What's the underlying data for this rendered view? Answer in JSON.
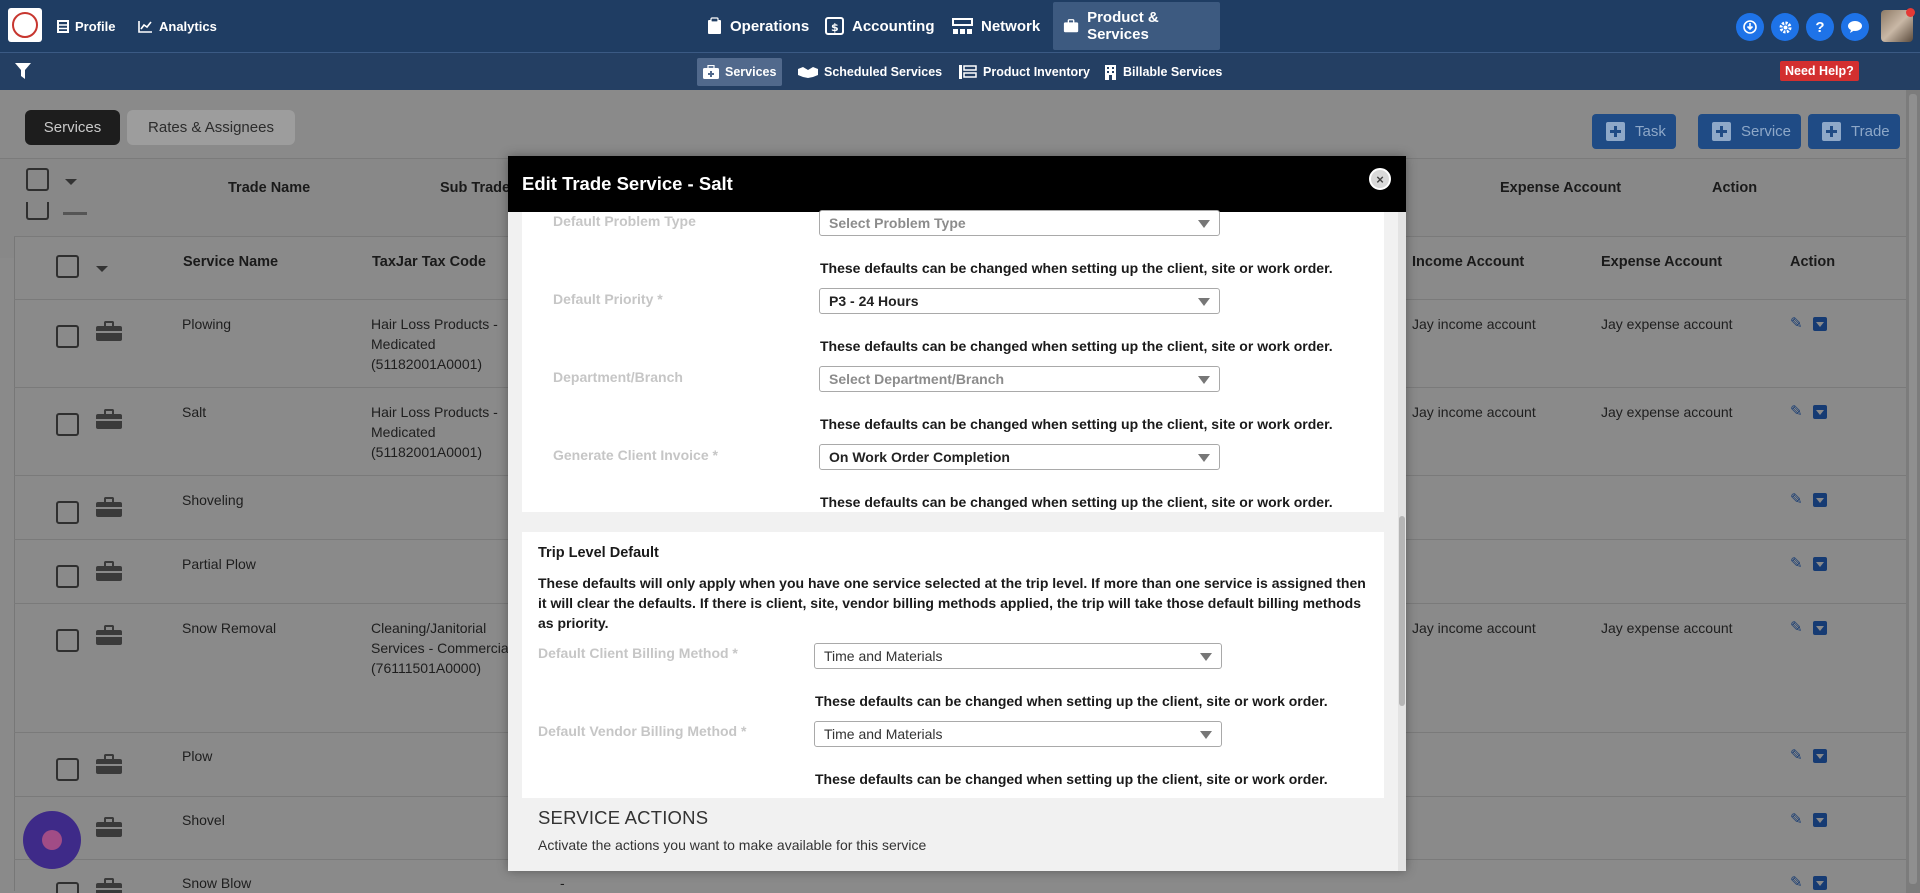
{
  "topbar": {
    "profile": "Profile",
    "analytics": "Analytics",
    "nav": [
      "Operations",
      "Accounting",
      "Network",
      "Product & Services"
    ],
    "help_icon_label": "?"
  },
  "subbar": {
    "items": [
      "Services",
      "Scheduled Services",
      "Product Inventory",
      "Billable Services"
    ],
    "need_help": "Need Help?"
  },
  "page": {
    "tabs": [
      "Services",
      "Rates & Assignees"
    ],
    "add_buttons": [
      "Task",
      "Service",
      "Trade"
    ],
    "outer_columns": [
      "Trade Name",
      "Sub Trade",
      "Expense Account",
      "Action"
    ],
    "inner_columns": [
      "Service Name",
      "TaxJar Tax Code",
      "Income Account",
      "Expense Account",
      "Action"
    ],
    "rows": [
      {
        "name": "Plowing",
        "tax1": "Hair Loss Products -",
        "tax2": "Medicated",
        "tax3": "(51182001A0001)",
        "income": "Jay income account",
        "expense": "Jay expense account"
      },
      {
        "name": "Salt",
        "tax1": "Hair Loss Products -",
        "tax2": "Medicated",
        "tax3": "(51182001A0001)",
        "income": "Jay income account",
        "expense": "Jay expense account"
      },
      {
        "name": "Shoveling",
        "tax1": "",
        "tax2": "",
        "tax3": "",
        "income": "",
        "expense": ""
      },
      {
        "name": "Partial Plow",
        "tax1": "",
        "tax2": "",
        "tax3": "",
        "income": "",
        "expense": ""
      },
      {
        "name": "Snow Removal",
        "tax1": "Cleaning/Janitorial",
        "tax2": "Services - Commercia",
        "tax3": "(76111501A0000)",
        "income": "Jay income account",
        "expense": "Jay expense account"
      },
      {
        "name": "Plow",
        "tax1": "",
        "tax2": "",
        "tax3": "",
        "income": "",
        "expense": ""
      },
      {
        "name": "Shovel",
        "tax1": "",
        "tax2": "",
        "tax3": "",
        "income": "",
        "expense": ""
      },
      {
        "name": "Snow Blow",
        "tax1": "",
        "tax2": "",
        "tax3": "",
        "income": "",
        "expense": ""
      }
    ],
    "snow_blow_dash": "-"
  },
  "modal": {
    "title": "Edit Trade Service - Salt",
    "close_label": "×",
    "help_text": "These defaults can be changed when setting up the client, site or work order.",
    "fields": [
      {
        "label": "Default Problem Type",
        "value": "Select Problem Type"
      },
      {
        "label": "Default Priority *",
        "value": "P3 - 24 Hours"
      },
      {
        "label": "Department/Branch",
        "value": "Select Department/Branch"
      },
      {
        "label": "Generate Client Invoice *",
        "value": "On Work Order Completion"
      }
    ],
    "trip": {
      "title": "Trip Level Default",
      "desc1": "These defaults will only apply when you have one service selected at the trip level. If more than one service is assigned then",
      "desc2": "it will clear the defaults. If there is client, site, vendor billing methods applied, the trip will take those default billing methods",
      "desc3": "as priority.",
      "fields": [
        {
          "label": "Default Client Billing Method *",
          "value": "Time and Materials"
        },
        {
          "label": "Default Vendor Billing Method *",
          "value": "Time and Materials"
        }
      ]
    },
    "actions": {
      "title": "SERVICE ACTIONS",
      "desc": "Activate the actions you want to make available for this service"
    }
  },
  "colors": {
    "topbar": "#1f3d63",
    "accent_blue": "#1e73e8",
    "need_help_red": "#d32f2f",
    "modal_header": "#000000"
  }
}
